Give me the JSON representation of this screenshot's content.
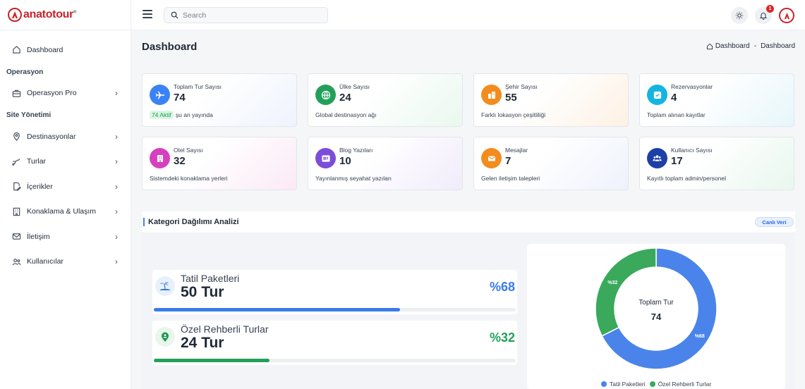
{
  "brand": {
    "name": "anatotour",
    "mark": "®"
  },
  "sidebar": {
    "items": [
      {
        "label": "Dashboard",
        "icon": "home-icon"
      },
      {
        "section": "Operasyon"
      },
      {
        "label": "Operasyon Pro",
        "icon": "briefcase-icon"
      },
      {
        "section": "Site Yönetimi"
      },
      {
        "label": "Destinasyonlar",
        "icon": "map-pin-icon"
      },
      {
        "label": "Turlar",
        "icon": "route-icon"
      },
      {
        "label": "İçerikler",
        "icon": "file-edit-icon"
      },
      {
        "label": "Konaklama & Ulaşım",
        "icon": "building-icon"
      },
      {
        "label": "İletişim",
        "icon": "mail-icon"
      },
      {
        "label": "Kullanıcılar",
        "icon": "users-icon"
      }
    ]
  },
  "topbar": {
    "search_placeholder": "Search",
    "notification_count": "1"
  },
  "header": {
    "title": "Dashboard",
    "breadcrumb": [
      "Dashboard",
      "-",
      "Dashboard"
    ]
  },
  "stats": [
    {
      "label": "Toplam Tur Sayısı",
      "value": "74",
      "badge": "74 Aktif",
      "desc": "şu an yayında",
      "color": "#3b82f6",
      "icon": "plane-icon"
    },
    {
      "label": "Ülke Sayısı",
      "value": "24",
      "desc": "Global destinasyon ağı",
      "color": "#22a05a",
      "icon": "globe-icon"
    },
    {
      "label": "Şehir Sayısı",
      "value": "55",
      "desc": "Farklı lokasyon çeşitliliği",
      "color": "#f28c1e",
      "icon": "city-icon"
    },
    {
      "label": "Rezervasyonlar",
      "value": "4",
      "desc": "Toplam alınan kayıtlar",
      "color": "#14b5e0",
      "icon": "calendar-check-icon"
    },
    {
      "label": "Otel Sayısı",
      "value": "32",
      "desc": "Sistemdeki konaklama yerleri",
      "color": "#d63fbf",
      "icon": "hotel-icon"
    },
    {
      "label": "Blog Yazıları",
      "value": "10",
      "desc": "Yayınlanmış seyahat yazıları",
      "color": "#7c4ddb",
      "icon": "newspaper-icon"
    },
    {
      "label": "Mesajlar",
      "value": "7",
      "desc": "Gelen iletişim talepleri",
      "color": "#f28c1e",
      "icon": "envelope-icon"
    },
    {
      "label": "Kullanıcı Sayısı",
      "value": "17",
      "desc": "Kayıtlı toplam admin/personel",
      "color": "#1d3fa8",
      "icon": "users-icon"
    }
  ],
  "analysis": {
    "title": "Kategori Dağılımı Analizi",
    "live_label": "Canlı Veri",
    "categories": [
      {
        "name": "Tatil Paketleri",
        "count": "50 Tur",
        "percent_label": "%68",
        "percent": 68,
        "color": "#3b7be6",
        "icon": "beach-icon"
      },
      {
        "name": "Özel Rehberli Turlar",
        "count": "24 Tur",
        "percent_label": "%32",
        "percent": 32,
        "color": "#22a05a",
        "icon": "location-pin-icon"
      }
    ]
  },
  "chart_data": {
    "type": "pie",
    "title": "",
    "center_label": "Toplam Tur",
    "center_value": "74",
    "categories": [
      "Tatil Paketleri",
      "Özel Rehberli Turlar"
    ],
    "values": [
      50,
      24
    ],
    "slice_labels": [
      "%68",
      "%32"
    ],
    "colors": [
      "#4a84ea",
      "#3aa95c"
    ],
    "legend": "bottom"
  }
}
